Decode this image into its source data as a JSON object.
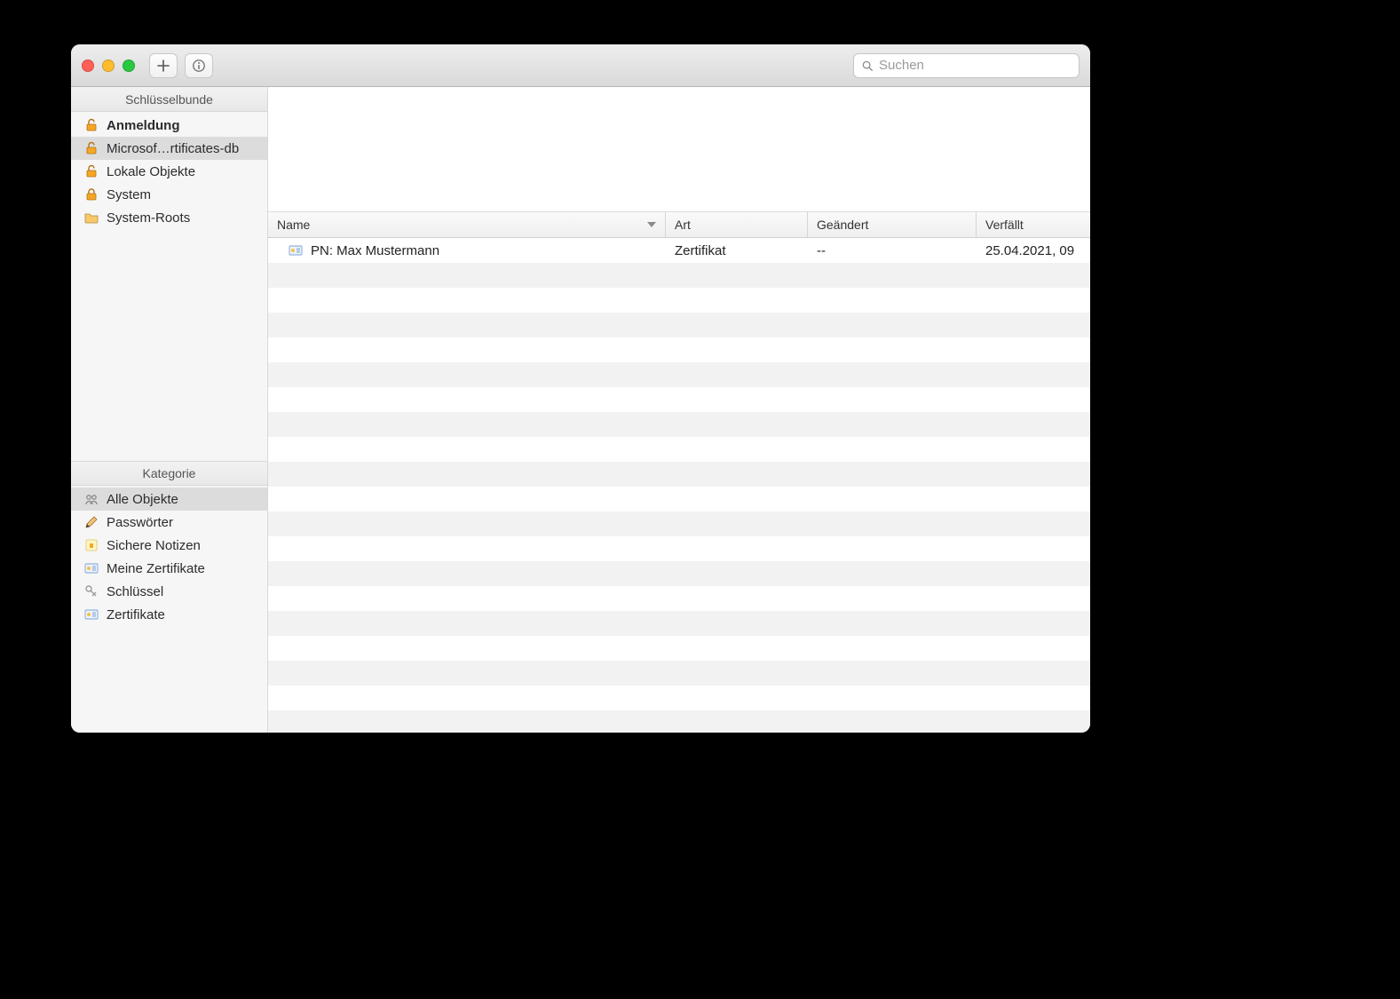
{
  "search": {
    "placeholder": "Suchen",
    "value": ""
  },
  "sidebar": {
    "keychains_header": "Schlüsselbunde",
    "category_header": "Kategorie",
    "keychains": [
      {
        "label": "Anmeldung",
        "icon": "lock-open",
        "bold": true,
        "selected": false
      },
      {
        "label": "Microsof…rtificates-db",
        "icon": "lock-open",
        "bold": false,
        "selected": true
      },
      {
        "label": "Lokale Objekte",
        "icon": "lock-open",
        "bold": false,
        "selected": false
      },
      {
        "label": "System",
        "icon": "lock-closed",
        "bold": false,
        "selected": false
      },
      {
        "label": "System-Roots",
        "icon": "folder",
        "bold": false,
        "selected": false
      }
    ],
    "categories": [
      {
        "label": "Alle Objekte",
        "icon": "all",
        "selected": true
      },
      {
        "label": "Passwörter",
        "icon": "pencil",
        "selected": false
      },
      {
        "label": "Sichere Notizen",
        "icon": "note",
        "selected": false
      },
      {
        "label": "Meine Zertifikate",
        "icon": "cert",
        "selected": false
      },
      {
        "label": "Schlüssel",
        "icon": "key",
        "selected": false
      },
      {
        "label": "Zertifikate",
        "icon": "cert",
        "selected": false
      }
    ]
  },
  "table": {
    "columns": {
      "name": "Name",
      "kind": "Art",
      "modified": "Geändert",
      "expires": "Verfällt"
    },
    "rows": [
      {
        "name": "PN: Max Mustermann",
        "kind": "Zertifikat",
        "modified": "--",
        "expires": "25.04.2021, 09"
      }
    ]
  }
}
